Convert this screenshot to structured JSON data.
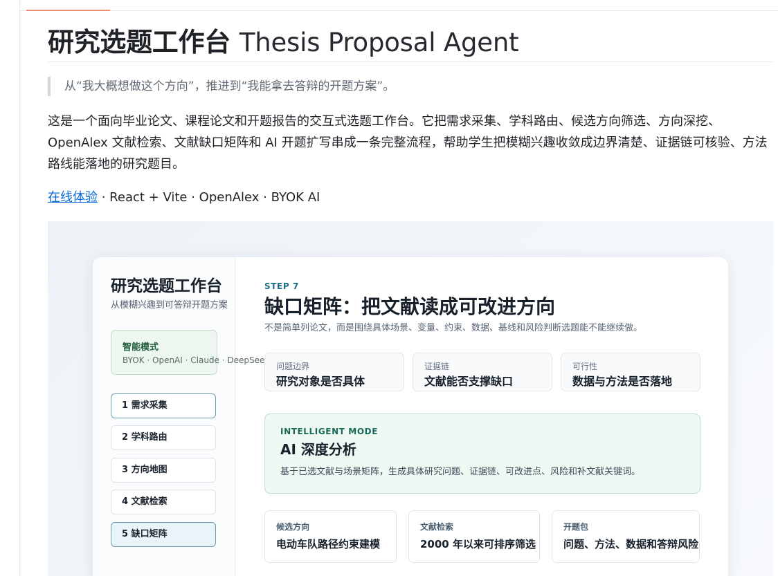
{
  "page": {
    "title_cn": "研究选题工作台",
    "title_en": "Thesis Proposal Agent",
    "quote": "从“我大概想做这个方向”，推进到“我能拿去答辩的开题方案”。",
    "description": "这是一个面向毕业论文、课程论文和开题报告的交互式选题工作台。它把需求采集、学科路由、候选方向筛选、方向深挖、OpenAlex 文献检索、文献缺口矩阵和 AI 开题扩写串成一条完整流程，帮助学生把模糊兴趣收敛成边界清楚、证据链可核验、方法路线能落地的研究题目。",
    "links": {
      "demo_label": "在线体验",
      "tags": " · React + Vite · OpenAlex · BYOK AI"
    }
  },
  "app": {
    "sidebar": {
      "title": "研究选题工作台",
      "subtitle": "从模糊兴趣到可答辩开题方案",
      "mode_card": {
        "title": "智能模式",
        "providers": "BYOK · OpenAI · Claude · DeepSeek ·"
      },
      "steps": [
        {
          "label": "1 需求采集",
          "state": "active"
        },
        {
          "label": "2 学科路由",
          "state": "default"
        },
        {
          "label": "3 方向地图",
          "state": "default"
        },
        {
          "label": "4 文献检索",
          "state": "default"
        },
        {
          "label": "5 缺口矩阵",
          "state": "current"
        }
      ]
    },
    "main": {
      "eyebrow": "STEP 7",
      "title": "缺口矩阵：把文献读成可改进方向",
      "subtitle": "不是简单列论文，而是围绕具体场景、变量、约束、数据、基线和风险判断选题能不能继续做。",
      "question_cards": [
        {
          "key": "问题边界",
          "value": "研究对象是否具体"
        },
        {
          "key": "证据链",
          "value": "文献能否支撑缺口"
        },
        {
          "key": "可行性",
          "value": "数据与方法是否落地"
        }
      ],
      "ai_card": {
        "eyebrow": "INTELLIGENT MODE",
        "title": "AI 深度分析",
        "description": "基于已选文献与场景矩阵，生成具体研究问题、证据链、可改进点、风险和补文献关键词。"
      },
      "bottom_cards": [
        {
          "key": "候选方向",
          "value": "电动车队路径约束建模"
        },
        {
          "key": "文献检索",
          "value": "2000 年以来可排序筛选"
        },
        {
          "key": "开题包",
          "value": "问题、方法、数据和答辩风险"
        }
      ]
    }
  },
  "colors": {
    "link": "#0969da",
    "accent_top": "#f08d6e",
    "intelligent_green": "#edf7f0",
    "step_active_border": "#6a9bb0",
    "step_current_bg": "#e9f4f9"
  }
}
